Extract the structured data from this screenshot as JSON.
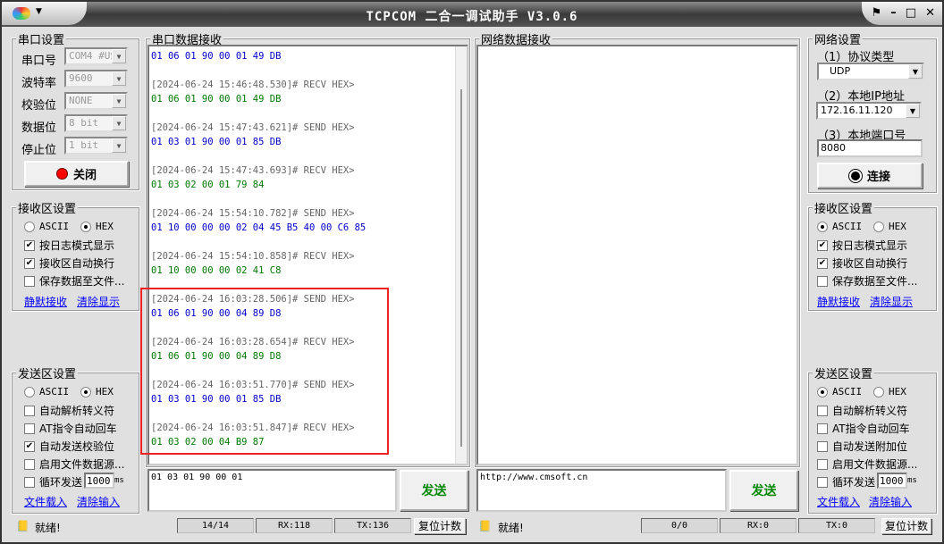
{
  "window": {
    "title": "TCPCOM 二合一调试助手  V3.0.6",
    "controls": [
      "–",
      "□",
      "✕"
    ]
  },
  "serial_settings": {
    "title": "串口设置",
    "fields": [
      {
        "label": "串口号",
        "value": "COM4 #US"
      },
      {
        "label": "波特率",
        "value": "9600"
      },
      {
        "label": "校验位",
        "value": "NONE"
      },
      {
        "label": "数据位",
        "value": "8 bit"
      },
      {
        "label": "停止位",
        "value": "1 bit"
      }
    ],
    "close_button": "关闭"
  },
  "left_recv": {
    "title": "接收区设置",
    "ascii": "ASCII",
    "hex": "HEX",
    "log_mode": "按日志模式显示",
    "auto_wrap": "接收区自动换行",
    "save_file": "保存数据至文件...",
    "silent": "静默接收",
    "clear": "清除显示"
  },
  "left_send": {
    "title": "发送区设置",
    "ascii": "ASCII",
    "hex": "HEX",
    "escape": "自动解析转义符",
    "at": "AT指令自动回车",
    "checksum": "自动发送校验位",
    "file_src": "启用文件数据源...",
    "loop": "循环发送",
    "interval": "1000",
    "ms": "ms",
    "load": "文件载入",
    "clear": "清除输入"
  },
  "serial_recv": {
    "title": "串口数据接收",
    "lines": [
      {
        "t": "s",
        "text": "01 06 01 90 00 01 49 DB"
      },
      {
        "t": "b",
        "text": ""
      },
      {
        "t": "h",
        "text": "[2024-06-24 15:46:48.530]# RECV HEX>"
      },
      {
        "t": "r",
        "text": "01 06 01 90 00 01 49 DB"
      },
      {
        "t": "b",
        "text": ""
      },
      {
        "t": "h",
        "text": "[2024-06-24 15:47:43.621]# SEND HEX>"
      },
      {
        "t": "s",
        "text": "01 03 01 90 00 01 85 DB"
      },
      {
        "t": "b",
        "text": ""
      },
      {
        "t": "h",
        "text": "[2024-06-24 15:47:43.693]# RECV HEX>"
      },
      {
        "t": "r",
        "text": "01 03 02 00 01 79 84"
      },
      {
        "t": "b",
        "text": ""
      },
      {
        "t": "h",
        "text": "[2024-06-24 15:54:10.782]# SEND HEX>"
      },
      {
        "t": "s",
        "text": "01 10 00 00 00 02 04 45 B5 40 00 C6 85"
      },
      {
        "t": "b",
        "text": ""
      },
      {
        "t": "h",
        "text": "[2024-06-24 15:54:10.858]# RECV HEX>"
      },
      {
        "t": "r",
        "text": "01 10 00 00 00 02 41 C8"
      },
      {
        "t": "b",
        "text": ""
      },
      {
        "t": "h",
        "text": "[2024-06-24 16:03:28.506]# SEND HEX>"
      },
      {
        "t": "s",
        "text": "01 06 01 90 00 04 89 D8"
      },
      {
        "t": "b",
        "text": ""
      },
      {
        "t": "h",
        "text": "[2024-06-24 16:03:28.654]# RECV HEX>"
      },
      {
        "t": "r",
        "text": "01 06 01 90 00 04 89 D8"
      },
      {
        "t": "b",
        "text": ""
      },
      {
        "t": "h",
        "text": "[2024-06-24 16:03:51.770]# SEND HEX>"
      },
      {
        "t": "s",
        "text": "01 03 01 90 00 01 85 DB"
      },
      {
        "t": "b",
        "text": ""
      },
      {
        "t": "h",
        "text": "[2024-06-24 16:03:51.847]# RECV HEX>"
      },
      {
        "t": "r",
        "text": "01 03 02 00 04 B9 87"
      }
    ]
  },
  "serial_send": {
    "input": "01 03 01 90 00 01",
    "button": "发送"
  },
  "net_recv": {
    "title": "网络数据接收"
  },
  "net_send": {
    "input": "http://www.cmsoft.cn",
    "button": "发送"
  },
  "net_settings": {
    "title": "网络设置",
    "protocol_label": "（1）协议类型",
    "protocol": "UDP",
    "ip_label": "（2）本地IP地址",
    "ip": "172.16.11.120",
    "port_label": "（3）本地端口号",
    "port": "8080",
    "connect": "连接"
  },
  "right_recv": {
    "title": "接收区设置",
    "ascii": "ASCII",
    "hex": "HEX",
    "log_mode": "按日志模式显示",
    "auto_wrap": "接收区自动换行",
    "save_file": "保存数据至文件...",
    "silent": "静默接收",
    "clear": "清除显示"
  },
  "right_send": {
    "title": "发送区设置",
    "ascii": "ASCII",
    "hex": "HEX",
    "escape": "自动解析转义符",
    "at": "AT指令自动回车",
    "append": "自动发送附加位",
    "file_src": "启用文件数据源...",
    "loop": "循环发送",
    "interval": "1000",
    "ms": "ms",
    "load": "文件载入",
    "clear": "清除输入"
  },
  "status_left": {
    "ready": "就绪!",
    "count": "14/14",
    "rx": "RX:118",
    "tx": "TX:136",
    "reset": "复位计数"
  },
  "status_right": {
    "ready": "就绪!",
    "count": "0/0",
    "rx": "RX:0",
    "tx": "TX:0",
    "reset": "复位计数"
  }
}
